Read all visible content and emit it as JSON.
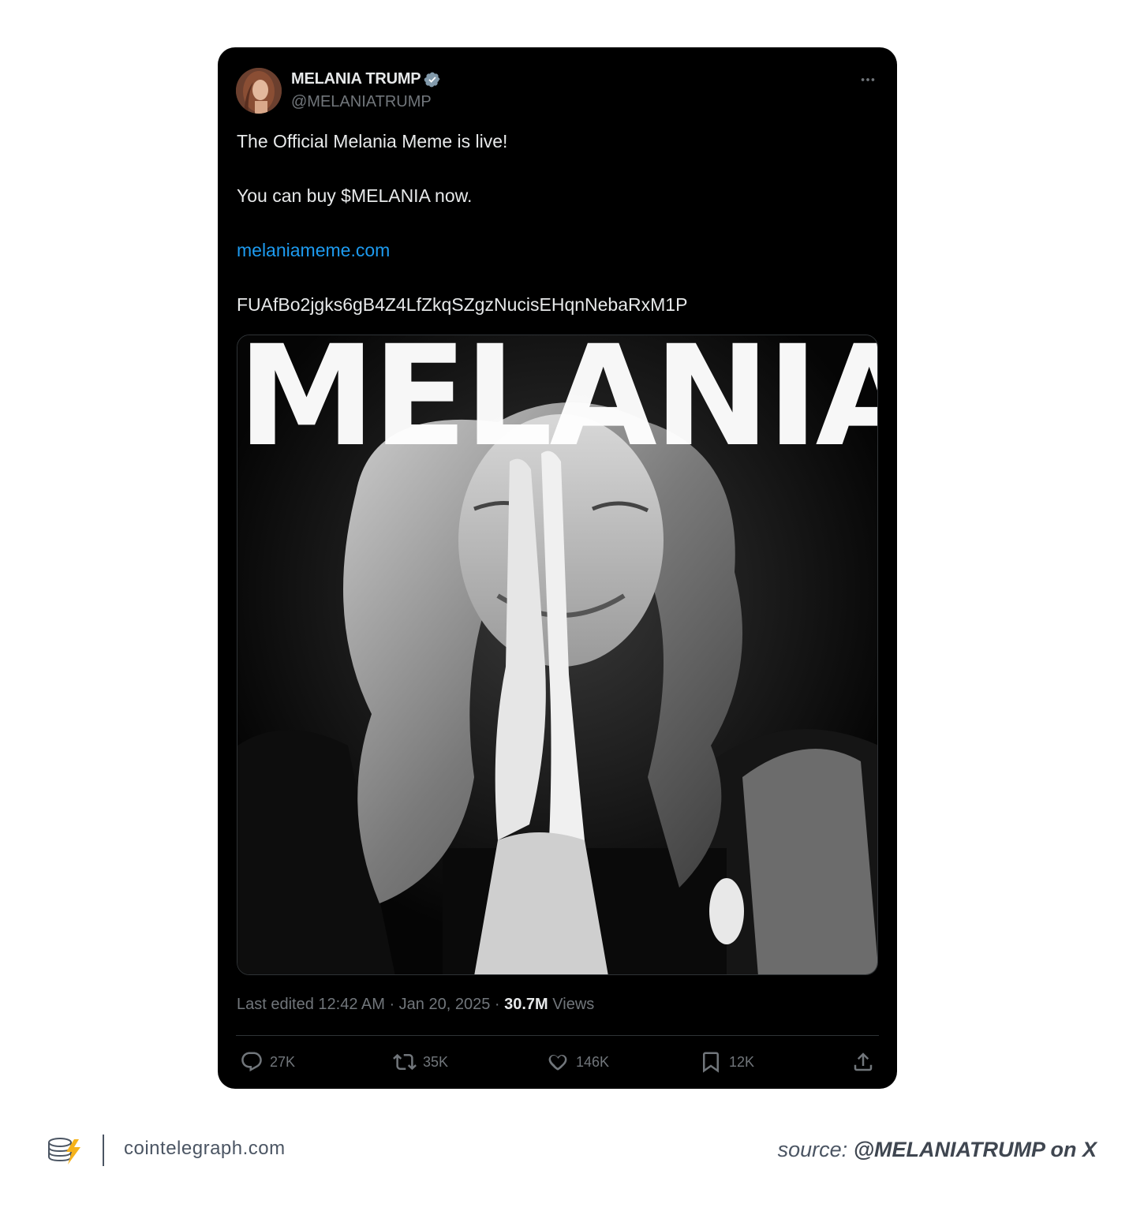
{
  "tweet": {
    "author_name": "MELANIA TRUMP",
    "author_handle": "@MELANIATRUMP",
    "lines": [
      "The Official Melania Meme is live!",
      "You can buy $MELANIA now.",
      "melaniameme.com",
      "FUAfBo2jgks6gB4Z4LfZkqSZgzNucisEHqnNebaRxM1P"
    ],
    "media_title": "MELANIA",
    "meta": {
      "edited": "Last edited 12:42 AM · Jan 20, 2025 · ",
      "views_count": "30.7M",
      "views_label": " Views"
    },
    "actions": {
      "replies": "27K",
      "reposts": "35K",
      "likes": "146K",
      "bookmarks": "12K"
    },
    "colors": {
      "background": "#000000",
      "link": "#1d9bf0",
      "verified": "#829aab",
      "muted": "#71767b"
    }
  },
  "footer": {
    "site": "cointelegraph.com",
    "source_prefix": "source: ",
    "source_bold": "@MELANIATRUMP on X"
  }
}
